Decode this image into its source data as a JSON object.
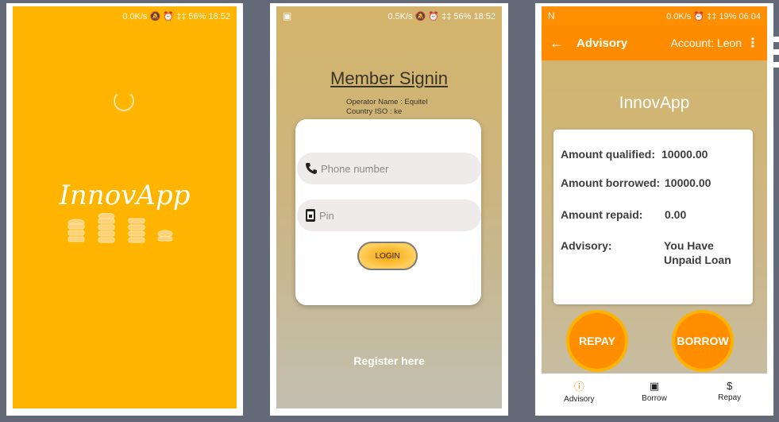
{
  "colors": {
    "splash_bg": "#ffb400",
    "appbar_bg": "#ff8c00",
    "button_orange": "#ff8d00",
    "page_bg": "#636a78"
  },
  "phone1": {
    "status": {
      "text": "0.0K/s 🔕 ⏰ ‡‡ 56% 18:52"
    },
    "logo": "InnovApp"
  },
  "phone2": {
    "status": {
      "text": "0.5K/s 🔕 ⏰ ‡‡ 56% 18:52"
    },
    "title": "Member Signin",
    "operator_line": "Operator Name : Equitel",
    "country_line": "Country ISO : ke",
    "phone_placeholder": "Phone number",
    "pin_placeholder": "Pin",
    "login_label": "LOGIN",
    "register_label": "Register here"
  },
  "phone3": {
    "status": {
      "text": "0.0K/s ⏰ ‡‡ 19% 06:04",
      "left": "N"
    },
    "appbar": {
      "back_icon": "←",
      "title": "Advisory",
      "account": "Account: Leon",
      "menu_icon": "⋮"
    },
    "brand": "InnovApp",
    "rows": [
      {
        "label": "Amount qualified:",
        "value": "10000.00"
      },
      {
        "label": "Amount borrowed:",
        "value": "10000.00"
      },
      {
        "label": "Amount repaid:",
        "value": "0.00"
      },
      {
        "label": "Advisory:",
        "value_line1": "You Have",
        "value_line2": "Unpaid Loan"
      }
    ],
    "repay_label": "REPAY",
    "borrow_label": "BORROW",
    "nav": [
      {
        "icon": "info-icon",
        "glyph": "ⓘ",
        "label": "Advisory"
      },
      {
        "icon": "wallet-icon",
        "glyph": "▣",
        "label": "Borrow"
      },
      {
        "icon": "dollar-icon",
        "glyph": "$",
        "label": "Repay"
      }
    ]
  }
}
